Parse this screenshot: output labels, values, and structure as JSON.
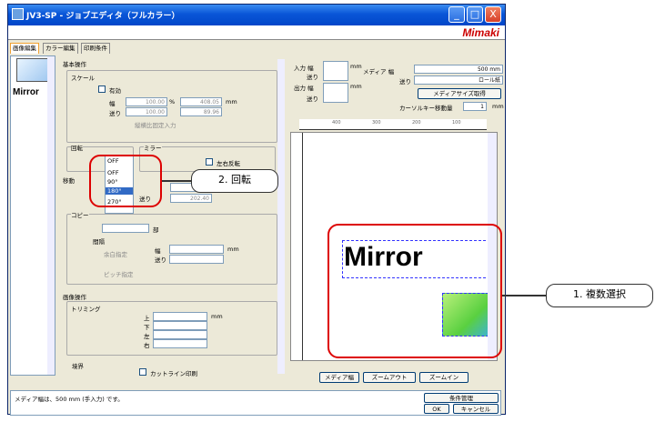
{
  "window": {
    "title": "JV3-SP - ジョブエディタ（フルカラー）",
    "min": "_",
    "max": "□",
    "close": "X"
  },
  "logo": "Mimaki",
  "tabs": [
    "画像編集",
    "カラー編集",
    "印刷条件"
  ],
  "thumb_label": "Mirror",
  "basic": {
    "group": "基本操作",
    "scale": {
      "title": "スケール",
      "enable": "有効",
      "width_label": "幅",
      "feed_label": "送り",
      "width_val": "100.00",
      "feed_val": "100.00",
      "pct": "%",
      "width_mm": "408.05",
      "feed_mm": "89.96",
      "mm": "mm",
      "aspect": "縦横比固定入力"
    },
    "rotate": {
      "title": "回転",
      "value": "OFF",
      "options": [
        "OFF",
        "90°",
        "180°",
        "270°"
      ],
      "selected": "180°"
    },
    "mirror": {
      "title": "ミラー",
      "lr": "左右反転"
    },
    "move": {
      "title": "移動",
      "x": "0.00",
      "y": "202.40",
      "feed": "送り"
    },
    "copy": {
      "title": "コピー",
      "unit": "部",
      "interval": "間隔",
      "auto": "余白指定",
      "pitch": "ピッチ指定",
      "w": "幅",
      "f": "送り",
      "mm": "mm"
    }
  },
  "image_ops": {
    "group": "画像操作",
    "trim": "トリミング",
    "top": "上",
    "bottom": "下",
    "left": "左",
    "right": "右",
    "mm": "mm",
    "border": "境界",
    "cutline": "カットライン印刷"
  },
  "media": {
    "input_w": "入力 幅",
    "feed": "送り",
    "output_w": "出力 幅",
    "mm": "mm",
    "media_w": "メディア 幅",
    "media_w_val": "500 mm",
    "media_feed_val": "ロール紙",
    "get_size": "メディアサイズ取得",
    "cursor_move": "カーソルキー移動量",
    "cursor_val": "1"
  },
  "ruler_marks": [
    "400",
    "300",
    "200",
    "100"
  ],
  "preview_text": "Mirror",
  "buttons": {
    "media_w": "メディア幅",
    "zoom_out": "ズームアウト",
    "zoom_in": "ズームイン",
    "cond": "条件管理",
    "ok": "OK",
    "cancel": "キャンセル"
  },
  "status": "メディア幅は、500 mm (手入力) です。",
  "callouts": {
    "rotate": "2. 回転",
    "multi": "1. 複数選択"
  }
}
